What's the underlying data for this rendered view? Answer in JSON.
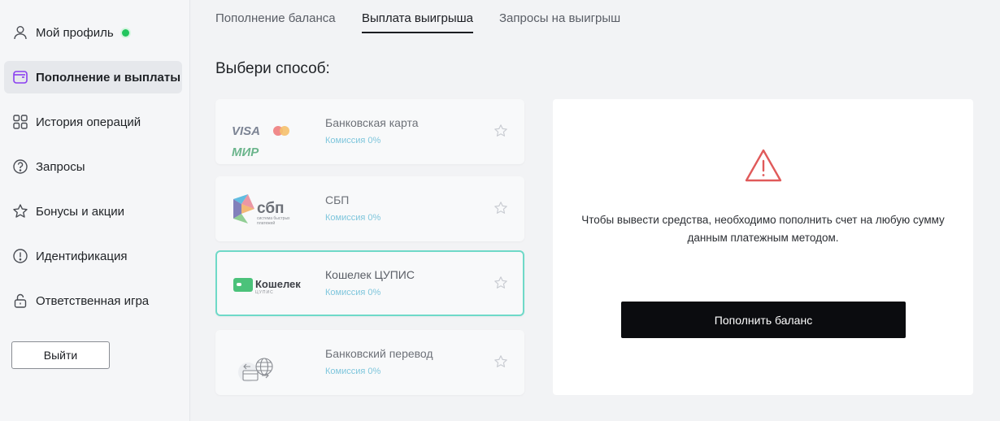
{
  "sidebar": {
    "items": [
      {
        "label": "Мой профиль",
        "icon": "user-icon",
        "online": true
      },
      {
        "label": "Пополнение и выплаты",
        "icon": "wallet-icon",
        "active": true
      },
      {
        "label": "История операций",
        "icon": "grid-icon"
      },
      {
        "label": "Запросы",
        "icon": "question-icon"
      },
      {
        "label": "Бонусы и акции",
        "icon": "star-icon"
      },
      {
        "label": "Идентификация",
        "icon": "info-icon"
      },
      {
        "label": "Ответственная игра",
        "icon": "lock-icon"
      }
    ],
    "logout_label": "Выйти",
    "online_color": "#21c55d"
  },
  "tabs": [
    {
      "label": "Пополнение баланса",
      "active": false
    },
    {
      "label": "Выплата выигрыша",
      "active": true
    },
    {
      "label": "Запросы на выигрыш",
      "active": false
    }
  ],
  "section_title": "Выбери способ:",
  "methods": [
    {
      "name": "Банковская карта",
      "fee": "Комиссия 0%",
      "logo": "visa-mastercard-mir-logo",
      "logo_text": [
        "VISA",
        "МИР"
      ],
      "selected": false
    },
    {
      "name": "СБП",
      "fee": "Комиссия 0%",
      "logo": "sbp-logo",
      "logo_text": [
        "сбп",
        "система быстрых",
        "платежей"
      ],
      "selected": false
    },
    {
      "name": "Кошелек ЦУПИС",
      "fee": "Комиссия 0%",
      "logo": "cupis-wallet-logo",
      "logo_text": [
        "Кошелек",
        "ЦУПИС"
      ],
      "selected": true
    },
    {
      "name": "Банковский перевод",
      "fee": "Комиссия 0%",
      "logo": "bank-transfer-logo",
      "selected": false
    }
  ],
  "panel": {
    "message": "Чтобы вывести средства, необходимо пополнить счет на любую сумму данным платежным методом.",
    "button_label": "Пополнить баланс",
    "warning_color": "#e05a5a"
  },
  "colors": {
    "accent_border": "#6fd9c8",
    "fee_text": "#7fc6dc",
    "button_bg": "#0b0c0f"
  }
}
